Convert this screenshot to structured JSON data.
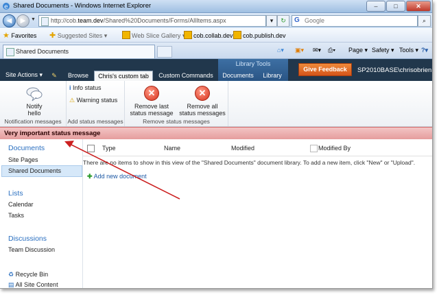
{
  "browser": {
    "window_title": "Shared Documents - Windows Internet Explorer",
    "window_buttons": [
      "–",
      "□",
      "✕"
    ],
    "address": {
      "prefix": "http://cob.",
      "host": "team.dev",
      "path": "/Shared%20Documents/Forms/AllItems.aspx"
    },
    "search_placeholder": "Google",
    "favorites": {
      "label": "Favorites",
      "items": [
        "Suggested Sites ▾",
        "Web Slice Gallery ▾",
        "cob.collab.dev",
        "cob.publish.dev"
      ]
    },
    "tab_title": "Shared Documents",
    "commands": [
      "Page ▾",
      "Safety ▾",
      "Tools ▾"
    ]
  },
  "sharepoint": {
    "site_actions": "Site Actions ▾",
    "tabs": [
      "Browse",
      "Chris's custom tab",
      "Custom Commands",
      "Documents",
      "Library"
    ],
    "contextual_group": "Library Tools",
    "feedback_button": "Give Feedback",
    "user": "SP2010BASE\\chrisobrien"
  },
  "ribbon": {
    "groups": [
      {
        "label": "Notification messages",
        "buttons": [
          "Notify hello"
        ]
      },
      {
        "label": "Add status messages",
        "buttons": [
          "Info status",
          "Warning status"
        ]
      },
      {
        "label": "Remove status messages",
        "buttons": [
          "Remove last status message",
          "Remove all status messages"
        ]
      }
    ]
  },
  "status_message": "Very important status message",
  "leftnav": {
    "documents_header": "Documents",
    "documents_items": [
      "Site Pages",
      "Shared Documents"
    ],
    "lists_header": "Lists",
    "lists_items": [
      "Calendar",
      "Tasks"
    ],
    "discussions_header": "Discussions",
    "discussions_items": [
      "Team Discussion"
    ],
    "recycle_bin": "Recycle Bin",
    "all_site_content": "All Site Content"
  },
  "list": {
    "columns": [
      "Type",
      "Name",
      "Modified",
      "Modified By"
    ],
    "empty_message": "There are no items to show in this view of the \"Shared Documents\" document library. To add a new item, click \"New\" or \"Upload\".",
    "add_new": "Add new document"
  }
}
